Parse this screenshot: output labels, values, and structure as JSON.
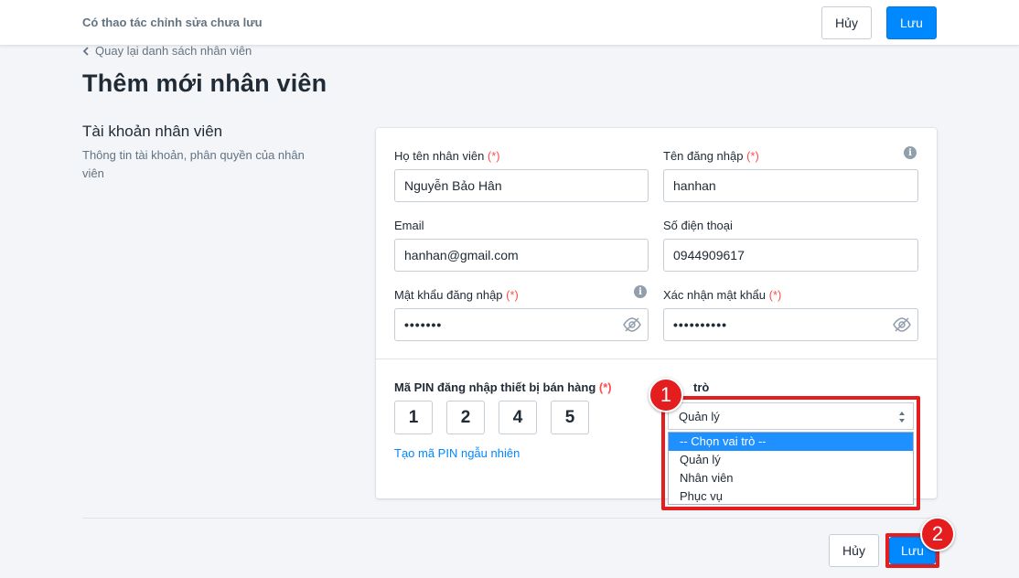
{
  "header": {
    "unsaved_text": "Có thao tác chỉnh sửa chưa lưu",
    "cancel_label": "Hủy",
    "save_label": "Lưu"
  },
  "breadcrumb": {
    "back_label": "Quay lại danh sách nhân viên"
  },
  "page": {
    "title": "Thêm mới nhân viên"
  },
  "section": {
    "title": "Tài khoản nhân viên",
    "description": "Thông tin tài khoản, phân quyền của nhân viên"
  },
  "form": {
    "required_mark": "(*)",
    "full_name": {
      "label": "Họ tên nhân viên",
      "value": "Nguyễn Bảo Hân"
    },
    "username": {
      "label": "Tên đăng nhập",
      "value": "hanhan"
    },
    "email": {
      "label": "Email",
      "value": "hanhan@gmail.com"
    },
    "phone": {
      "label": "Số điện thoại",
      "value": "0944909617"
    },
    "password": {
      "label": "Mật khẩu đăng nhập",
      "value": "•••••••"
    },
    "confirm_password": {
      "label": "Xác nhận mật khẩu",
      "value": "••••••••••"
    },
    "pin": {
      "label": "Mã PIN đăng nhập thiết bị bán hàng",
      "digits": [
        "1",
        "2",
        "4",
        "5"
      ],
      "random_link": "Tạo mã PIN ngẫu nhiên"
    },
    "role": {
      "label": "trò",
      "selected": "Quản lý",
      "options": [
        "-- Chọn vai trò --",
        "Quản lý",
        "Nhân viên",
        "Phục vụ"
      ]
    }
  },
  "footer": {
    "cancel_label": "Hủy",
    "save_label": "Lưu"
  },
  "annotations": {
    "step1": "1",
    "step2": "2"
  },
  "colors": {
    "accent": "#0088ff",
    "required": "#ff4d4d",
    "highlight": "#e41e1e"
  }
}
